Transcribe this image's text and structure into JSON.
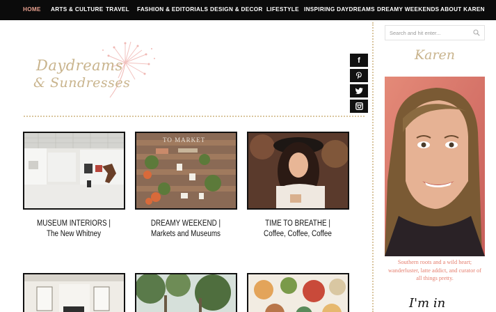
{
  "nav": {
    "items": [
      {
        "label": "HOME"
      },
      {
        "label": "ARTS & CULTURE"
      },
      {
        "label": "TRAVEL"
      },
      {
        "label": "FASHION & EDITORIALS"
      },
      {
        "label": "DESIGN & DECOR"
      },
      {
        "label": "LIFESTYLE"
      },
      {
        "label": "INSPIRING DAYDREAMS"
      },
      {
        "label": "DREAMY WEEKENDS"
      },
      {
        "label": "ABOUT KAREN"
      }
    ],
    "active_color": "#e8a08f"
  },
  "logo": {
    "line1": "Daydreams",
    "line2": "& Sundresses"
  },
  "social": [
    {
      "icon": "facebook-icon",
      "glyph": "f"
    },
    {
      "icon": "pinterest-icon",
      "glyph": "p"
    },
    {
      "icon": "twitter-icon",
      "glyph": "🐦"
    },
    {
      "icon": "instagram-icon",
      "glyph": "◘"
    }
  ],
  "posts": [
    {
      "title_line1": "MUSEUM INTERIORS |",
      "title_line2": "The New Whitney"
    },
    {
      "title_line1": "DREAMY WEEKEND |",
      "title_line2": "Markets and Museums"
    },
    {
      "title_line1": "TIME TO BREATHE |",
      "title_line2": "Coffee, Coffee, Coffee"
    }
  ],
  "sidebar": {
    "search_placeholder": "Search and hit enter...",
    "widget_title": "Karen",
    "bio": "Southern roots and a wild heart; wanderluster, latte addict, and curator of all things pretty.",
    "signature": "I'm in"
  },
  "colors": {
    "gold": "#c9b48d",
    "coral": "#e57e6e",
    "nav_bg": "#0b0b0b"
  }
}
